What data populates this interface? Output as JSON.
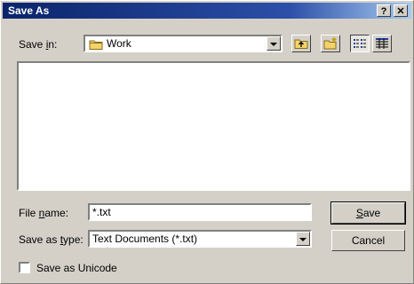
{
  "window": {
    "title": "Save As"
  },
  "titlebar": {
    "help_label": "?",
    "close_label": "✕"
  },
  "save_in": {
    "label_pre": "Save ",
    "label_u": "i",
    "label_post": "n:",
    "value": "Work",
    "icon": "folder-icon"
  },
  "toolbar": {
    "up_icon": "up-folder-icon",
    "new_folder_icon": "new-folder-icon",
    "list_icon": "list-view-icon",
    "details_icon": "details-view-icon"
  },
  "file_name": {
    "label_pre": "File ",
    "label_u": "n",
    "label_post": "ame:",
    "value": "*.txt"
  },
  "save_as_type": {
    "label_pre": "Save as ",
    "label_u": "t",
    "label_post": "ype:",
    "value": "Text Documents (*.txt)"
  },
  "buttons": {
    "save_u": "S",
    "save_rest": "ave",
    "cancel": "Cancel"
  },
  "unicode_checkbox": {
    "label": "Save as Unicode",
    "checked": false
  }
}
